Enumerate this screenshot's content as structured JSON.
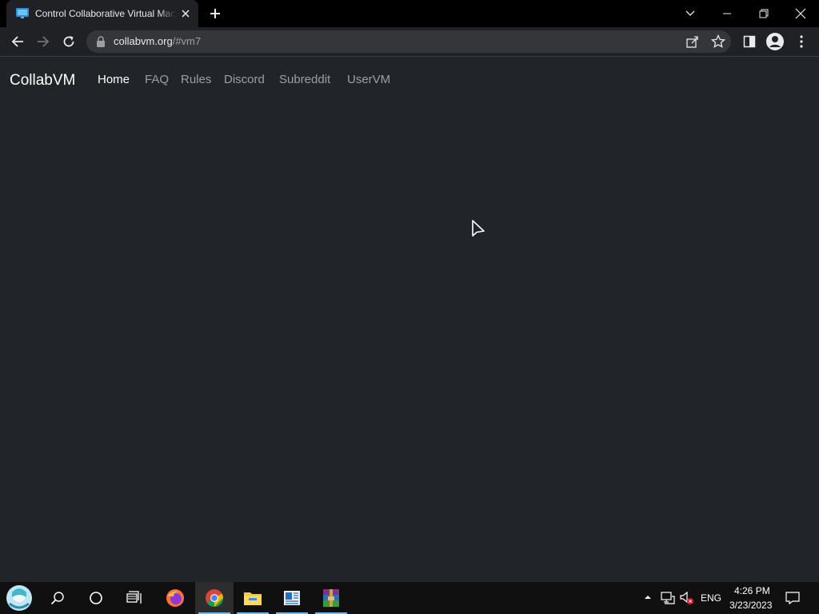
{
  "browser": {
    "tab_title": "Control Collaborative Virtual Machines!",
    "url_host": "collabvm.org",
    "url_rest": "/#vm7"
  },
  "navbar": {
    "brand": "CollabVM",
    "links": [
      {
        "label": "Home",
        "active": true
      },
      {
        "label": "FAQ",
        "active": false
      },
      {
        "label": "Rules",
        "active": false
      },
      {
        "label": "Discord",
        "active": false
      },
      {
        "label": "Subreddit",
        "active": false
      },
      {
        "label": "UserVM",
        "active": false
      }
    ]
  },
  "taskbar": {
    "apps": [
      "start-icon",
      "search-icon",
      "cortana-icon",
      "task-view-icon",
      "firefox-icon",
      "chrome-icon",
      "file-explorer-icon",
      "news-icon",
      "winrar-icon"
    ],
    "language": "ENG",
    "time": "4:26 PM",
    "date": "3/23/2023"
  },
  "colors": {
    "page_bg": "#212529",
    "chrome_bg": "#202124",
    "taskbar_bg": "#101010",
    "accent": "#76b9ed"
  }
}
